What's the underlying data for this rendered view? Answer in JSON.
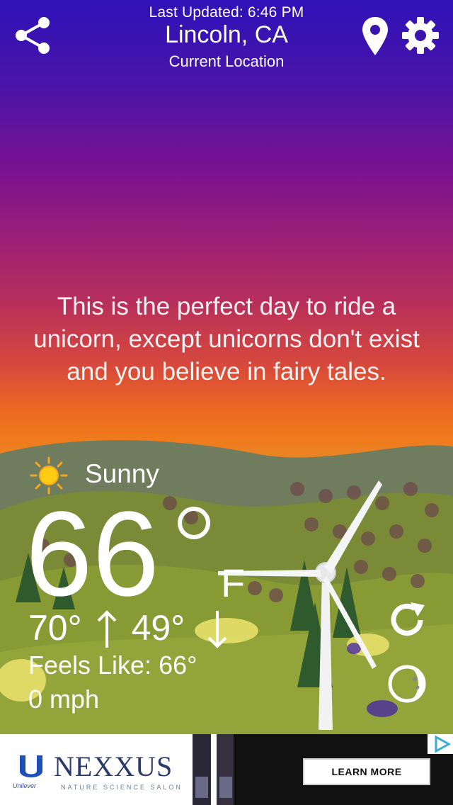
{
  "header": {
    "last_updated": "Last Updated: 6:46 PM",
    "city": "Lincoln, CA",
    "location_label": "Current Location"
  },
  "icons": {
    "share": "share-icon",
    "location": "location-pin-icon",
    "settings": "gear-icon",
    "condition": "sun-icon",
    "refresh": "refresh-icon",
    "moon": "moon-phase-icon"
  },
  "quote": "This is the perfect day to ride a unicorn, except unicorns don't exist and you believe in fairy tales.",
  "weather": {
    "condition": "Sunny",
    "temperature": "66",
    "unit": "F",
    "high": "70°",
    "low": "49°",
    "feels_like": "Feels Like: 66°",
    "wind": "0 mph"
  },
  "ad": {
    "brand": "NEXXUS",
    "tagline": "NATURE SCIENCE SALON",
    "parent_brand": "Unilever",
    "cta": "LEARN MORE"
  },
  "colors": {
    "sky_top": "#2e12b8",
    "sky_mid": "#9a1e78",
    "sky_bottom": "#f07a1c",
    "grass": "#7d8a2e",
    "hills": "#6a7a60"
  }
}
